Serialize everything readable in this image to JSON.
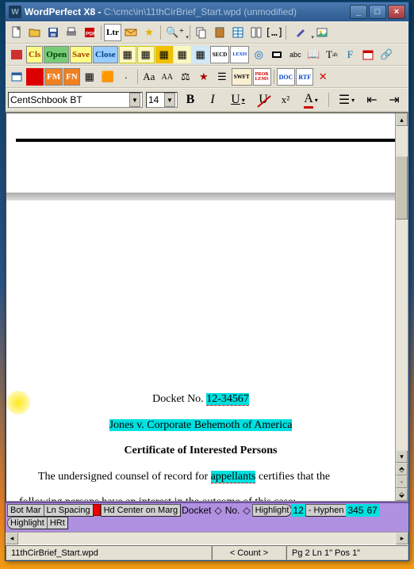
{
  "titlebar": {
    "app": "WordPerfect X8",
    "sep": " - ",
    "path": "C:\\cmc\\in\\11thCirBrief_Start.wpd",
    "state": " (unmodified)"
  },
  "winbtns": {
    "min": "_",
    "max": "□",
    "close": "×"
  },
  "format": {
    "font": "CentSchbook BT",
    "size": "14",
    "bold": "B",
    "italic": "I",
    "uline": "U",
    "noul": "U",
    "sup": "x²",
    "color": "A",
    "just_left": "≡",
    "just_ctr": "≡",
    "ind": "→|",
    "out": "|←"
  },
  "doc": {
    "docket_prefix": "Docket No. ",
    "docket_no": "12-34567",
    "case_name": "Jones v. Corporate Behemoth of America",
    "cip_title": "Certificate of Interested Persons",
    "body1_a": "The undersigned counsel of record for ",
    "body1_hl": "appellants",
    "body1_b": " certifies that the",
    "body2": "following persons have an interest in the outcome of this case:",
    "ellips1": "...",
    "ellips2": "..."
  },
  "codes": {
    "bot_mar": "Bot Mar",
    "ln_sp": "Ln Spacing",
    "hd_ctr": "Hd Center on Marg",
    "docket": "Docket",
    "diamond": "◇",
    "no": "No.",
    "hl_on": "Highlight",
    "t12": "12",
    "hyphen": "- Hyphen",
    "t345": "345",
    "t67": "67",
    "hl_off": "Highlight",
    "hrt": "HRt"
  },
  "status": {
    "filename": "11thCirBrief_Start.wpd",
    "count": "< Count >",
    "pos": "Pg 2 Ln 1\" Pos 1\""
  },
  "tb": {
    "new": "new",
    "open": "open",
    "save": "save",
    "print": "print",
    "pdf": "PDF",
    "pg": "pg",
    "ltr": "Ltr",
    "env": "env",
    "star": "star",
    "zoom": "zoom",
    "para": "para",
    "cut": "cut",
    "copy": "copy",
    "paste": "paste",
    "table": "tbl",
    "cols": "cols",
    "fx": "fx",
    "pen": "pen",
    "img": "img",
    "g1": "📕",
    "g2": "Cls",
    "g3": "Open",
    "g4": "Save",
    "g5": "Close",
    "b1": "b",
    "b2": "b",
    "b3": "b",
    "b4": "b",
    "b5": "b",
    "secd": "SECD",
    "lexis": "LEXIS",
    "ring": "◎",
    "bw": "■",
    "abc": "abc",
    "dict": "📖",
    "tab": "T",
    "fmt": "F",
    "cal": "cal",
    "link": "∞",
    "dlg": "dlg",
    "r1": "FM",
    "r2": "FN",
    "r3": "u",
    "orange": "■",
    "dotx": "·",
    "aa": "Aa",
    "caps": "AA",
    "scale": "⚖",
    "star2": "★",
    "list": "≡",
    "swft": "SWFT",
    "prob": "PROB",
    "doc_i": "DOC",
    "rtf": "RTF",
    "x": "✕"
  }
}
